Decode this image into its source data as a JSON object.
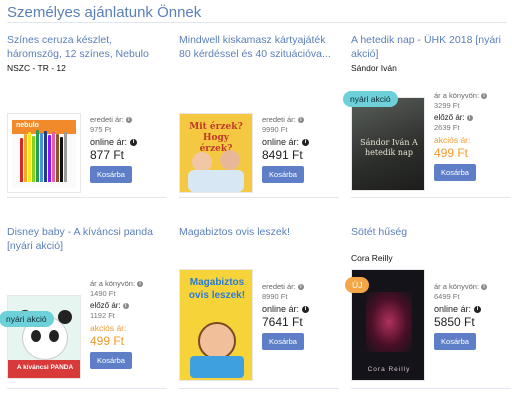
{
  "page": {
    "title": "Személyes ajánlatunk Önnek"
  },
  "labels": {
    "eredeti": "eredeti ár:",
    "online": "online ár:",
    "konyvon": "ár a könyvön:",
    "elozo": "előző ár:",
    "akcios": "akciós ár:",
    "cart": "Kosárba"
  },
  "products": [
    {
      "title": "Színes ceruza készlet, háromszög, 12 színes, Nebulo",
      "author": "NSZC - TR - 12",
      "original_price": "975 Ft",
      "online_price": "877 Ft",
      "cover_text": "nebulo"
    },
    {
      "title": "Mindwell kiskamasz kártyajáték 80 kérdéssel és 40 szituációva...",
      "original_price": "9990 Ft",
      "online_price": "8491 Ft",
      "cover_text": "Mit érzek? Hogy érzek?"
    },
    {
      "title": "A hetedik nap - ÜHK 2018 [nyári akció]",
      "author": "Sándor Iván",
      "badge": "nyári akció",
      "book_price": "3299 Ft",
      "prev_price": "2639 Ft",
      "sale_price": "499 Ft",
      "cover_text": "Sándor Iván A hetedik nap"
    },
    {
      "title": "Disney baby - A kíváncsi panda [nyári akció]",
      "badge": "nyári akció",
      "book_price": "1490 Ft",
      "prev_price": "1192 Ft",
      "sale_price": "499 Ft",
      "cover_text": "A kíváncsi PANDA"
    },
    {
      "title": "Magabiztos ovis leszek!",
      "original_price": "8990 Ft",
      "online_price": "7641 Ft",
      "cover_text": "Magabiztos ovis leszek!"
    },
    {
      "title": "Sötét hűség",
      "author": "Cora Reilly",
      "badge": "ÚJ",
      "book_price": "6499 Ft",
      "online_price": "5850 Ft",
      "cover_text": "Cora Reilly"
    }
  ],
  "colors": {
    "link": "#5b7fb8",
    "button": "#5e7fc8",
    "sale": "#f09a2a",
    "badge_summer": "#6ed0d8",
    "badge_new": "#f4a545"
  }
}
